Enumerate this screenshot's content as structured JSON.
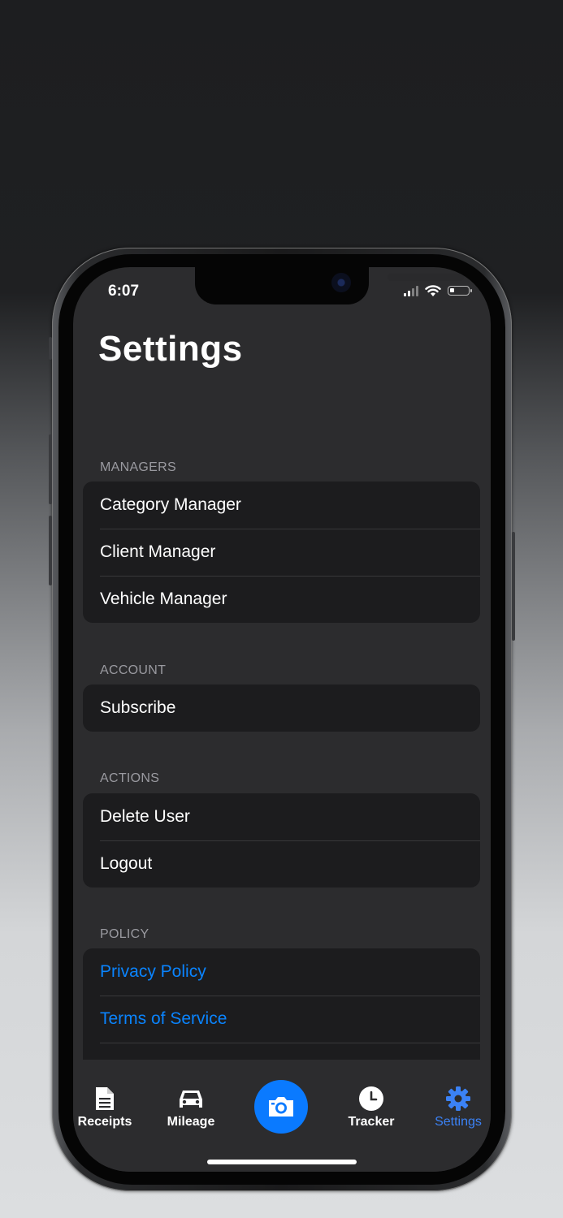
{
  "status_bar": {
    "time": "6:07"
  },
  "page": {
    "title": "Settings"
  },
  "sections": [
    {
      "header": "MANAGERS",
      "items": [
        "Category Manager",
        "Client Manager",
        "Vehicle Manager"
      ]
    },
    {
      "header": "ACCOUNT",
      "items": [
        "Subscribe"
      ]
    },
    {
      "header": "ACTIONS",
      "items": [
        "Delete User",
        "Logout"
      ]
    },
    {
      "header": "POLICY",
      "items": [
        "Privacy Policy",
        "Terms of Service"
      ]
    }
  ],
  "tab_bar": {
    "receipts": "Receipts",
    "mileage": "Mileage",
    "tracker": "Tracker",
    "settings": "Settings",
    "active": "Settings"
  },
  "colors": {
    "accent": "#0a84ff",
    "background": "#2c2c2e",
    "group": "#1c1c1e"
  },
  "icons": [
    "document-icon",
    "car-icon",
    "camera-icon",
    "clock-icon",
    "gear-icon"
  ]
}
